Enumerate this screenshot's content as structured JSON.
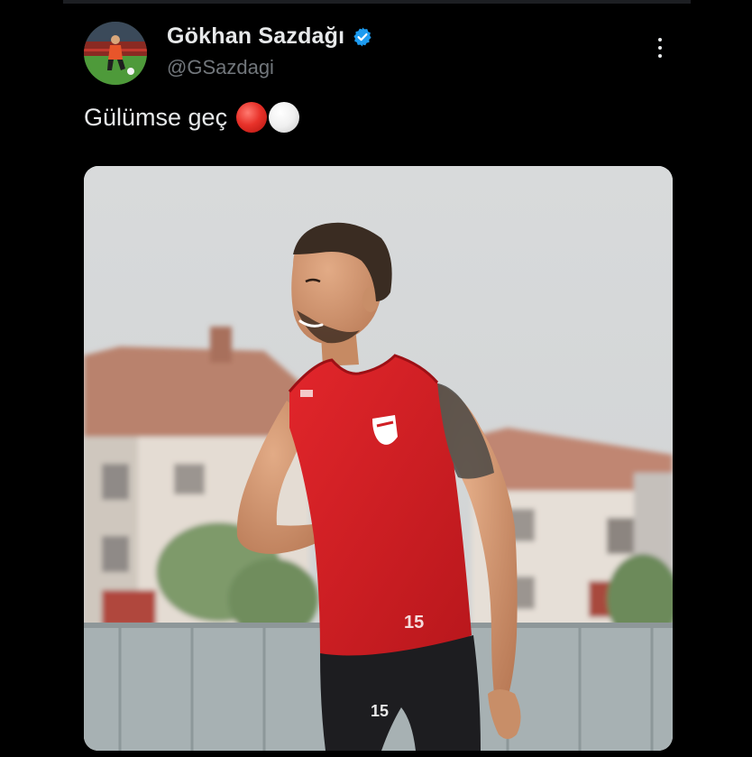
{
  "tweet": {
    "author": {
      "display_name": "Gökhan Sazdağı",
      "handle": "@GSazdagi",
      "verified": true,
      "avatar_icon": "avatar-photo"
    },
    "text": "Gülümse geç",
    "emojis": [
      "red-circle",
      "white-circle"
    ],
    "more_icon": "more-vertical-icon",
    "media": {
      "type": "photo",
      "jersey_number": "15",
      "shorts_number": "15"
    }
  },
  "colors": {
    "background": "#000000",
    "text_primary": "#e7e9ea",
    "text_secondary": "#71767b",
    "verified_blue": "#1d9bf0",
    "jersey_red": "#d01f24"
  }
}
